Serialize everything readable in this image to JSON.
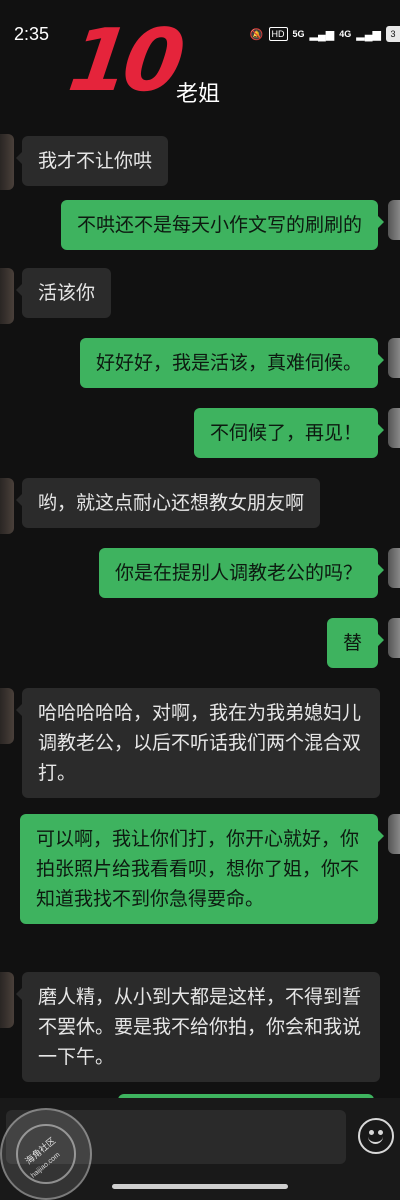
{
  "status_bar": {
    "time": "2:35",
    "hd_label": "HD",
    "net1": "5G",
    "net2": "4G",
    "battery": "3"
  },
  "header": {
    "overlay_number": "10",
    "contact_name": "老姐"
  },
  "colors": {
    "incoming_bubble": "#2b2b2b",
    "outgoing_bubble": "#3eb35f",
    "overlay_red": "#e5243b"
  },
  "messages": [
    {
      "side": "in",
      "text": "我才不让你哄"
    },
    {
      "side": "out",
      "text": "不哄还不是每天小作文写的刷刷的"
    },
    {
      "side": "in",
      "text": "活该你"
    },
    {
      "side": "out",
      "text": "好好好，我是活该，真难伺候。"
    },
    {
      "side": "out",
      "text": "不伺候了，再见！"
    },
    {
      "side": "in",
      "text": "哟，就这点耐心还想教女朋友啊"
    },
    {
      "side": "out",
      "text": "你是在提别人调教老公的吗？"
    },
    {
      "side": "out",
      "text": "替"
    },
    {
      "side": "in",
      "text": "哈哈哈哈哈，对啊，我在为我弟媳妇儿调教老公，以后不听话我们两个混合双打。"
    },
    {
      "side": "out",
      "text": "可以啊，我让你们打，你开心就好，你拍张照片给我看看呗，想你了姐，你不知道我找不到你急得要命。"
    },
    {
      "side": "in",
      "text": "磨人精，从小到大都是这样，不得到誓不罢休。要是我不给你拍，你会和我说一下午。"
    }
  ],
  "input_bar": {
    "emoji_icon": "emoji-icon"
  },
  "watermark": {
    "text": "海角社区",
    "sub": "haijiao.com"
  }
}
